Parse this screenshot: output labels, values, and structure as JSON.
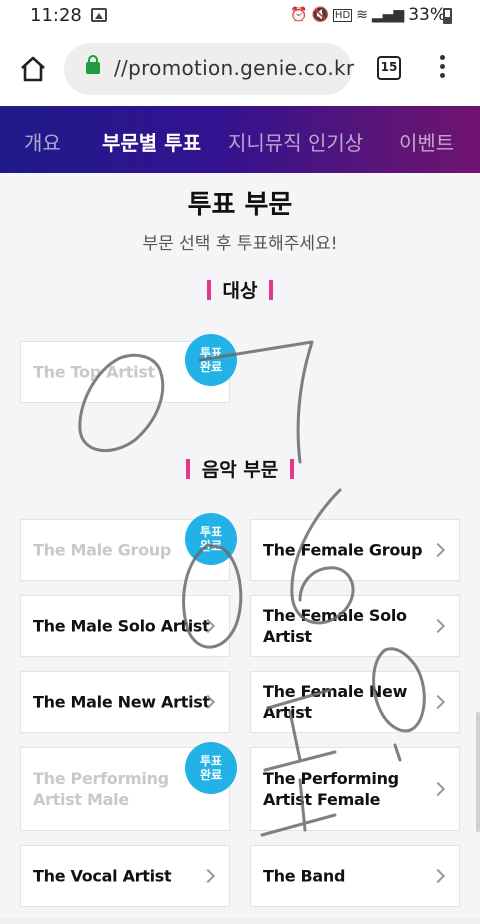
{
  "status_bar": {
    "time": "11:28",
    "battery_pct": "33%",
    "hd_label": "HD"
  },
  "browser": {
    "url": "//promotion.genie.co.kr",
    "tab_count": "15"
  },
  "nav": {
    "tabs": [
      {
        "label": "개요",
        "active": false
      },
      {
        "label": "부문별 투표",
        "active": true
      },
      {
        "label": "지니뮤직 인기상",
        "active": false
      },
      {
        "label": "이벤트",
        "active": false
      }
    ]
  },
  "page": {
    "title": "투표 부문",
    "subtitle": "부문 선택 후 투표해주세요!"
  },
  "grand_prize": {
    "heading": "대상",
    "items": [
      {
        "label": "The Top Artist",
        "voted": true
      }
    ]
  },
  "music": {
    "heading": "음악 부문",
    "items": [
      {
        "label": "The Male Group",
        "voted": true
      },
      {
        "label": "The Female Group",
        "voted": false
      },
      {
        "label": "The Male Solo Artist",
        "voted": false
      },
      {
        "label": "The Female Solo Artist",
        "voted": false
      },
      {
        "label": "The Male New Artist",
        "voted": false
      },
      {
        "label": "The Female New Artist",
        "voted": false
      },
      {
        "label": "The Performing Artist Male",
        "voted": true
      },
      {
        "label": "The Performing Artist Female",
        "voted": false
      },
      {
        "label": "The Vocal Artist",
        "voted": false
      },
      {
        "label": "The Band",
        "voted": false
      }
    ]
  },
  "badge": {
    "line1": "투표",
    "line2": "완료",
    "color": "#23b2e6"
  },
  "colors": {
    "nav_start": "#1f1a8a",
    "nav_end": "#70136e",
    "accent_bar": "#e6378f"
  }
}
